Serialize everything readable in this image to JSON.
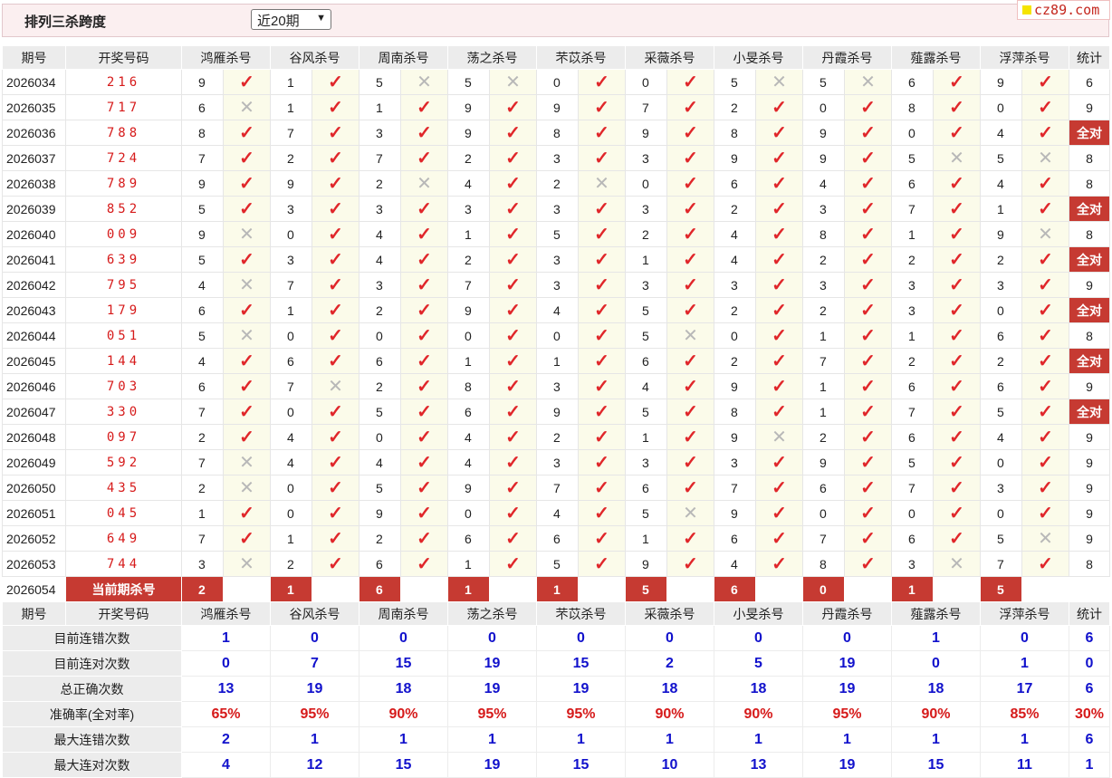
{
  "header": {
    "title": "排列三杀跨度",
    "period_select": "近20期",
    "site_logo": "cz89.com"
  },
  "columns": {
    "period": "期号",
    "number": "开奖号码",
    "experts": [
      "鸿雁杀号",
      "谷风杀号",
      "周南杀号",
      "荡之杀号",
      "芣苡杀号",
      "采薇杀号",
      "小旻杀号",
      "丹霞杀号",
      "薤露杀号",
      "浮萍杀号"
    ],
    "stat": "统计"
  },
  "rows": [
    {
      "period": "2026034",
      "number": "216",
      "kills": [
        9,
        1,
        5,
        5,
        0,
        0,
        5,
        5,
        6,
        9
      ],
      "ok": [
        1,
        1,
        0,
        0,
        1,
        1,
        0,
        0,
        1,
        1
      ],
      "stat": "6"
    },
    {
      "period": "2026035",
      "number": "717",
      "kills": [
        6,
        1,
        1,
        9,
        9,
        7,
        2,
        0,
        8,
        0
      ],
      "ok": [
        0,
        1,
        1,
        1,
        1,
        1,
        1,
        1,
        1,
        1
      ],
      "stat": "9"
    },
    {
      "period": "2026036",
      "number": "788",
      "kills": [
        8,
        7,
        3,
        9,
        8,
        9,
        8,
        9,
        0,
        4
      ],
      "ok": [
        1,
        1,
        1,
        1,
        1,
        1,
        1,
        1,
        1,
        1
      ],
      "stat": "全对"
    },
    {
      "period": "2026037",
      "number": "724",
      "kills": [
        7,
        2,
        7,
        2,
        3,
        3,
        9,
        9,
        5,
        5
      ],
      "ok": [
        1,
        1,
        1,
        1,
        1,
        1,
        1,
        1,
        0,
        0
      ],
      "stat": "8"
    },
    {
      "period": "2026038",
      "number": "789",
      "kills": [
        9,
        9,
        2,
        4,
        2,
        0,
        6,
        4,
        6,
        4
      ],
      "ok": [
        1,
        1,
        0,
        1,
        0,
        1,
        1,
        1,
        1,
        1
      ],
      "stat": "8"
    },
    {
      "period": "2026039",
      "number": "852",
      "kills": [
        5,
        3,
        3,
        3,
        3,
        3,
        2,
        3,
        7,
        1
      ],
      "ok": [
        1,
        1,
        1,
        1,
        1,
        1,
        1,
        1,
        1,
        1
      ],
      "stat": "全对"
    },
    {
      "period": "2026040",
      "number": "009",
      "kills": [
        9,
        0,
        4,
        1,
        5,
        2,
        4,
        8,
        1,
        9
      ],
      "ok": [
        0,
        1,
        1,
        1,
        1,
        1,
        1,
        1,
        1,
        0
      ],
      "stat": "8"
    },
    {
      "period": "2026041",
      "number": "639",
      "kills": [
        5,
        3,
        4,
        2,
        3,
        1,
        4,
        2,
        2,
        2
      ],
      "ok": [
        1,
        1,
        1,
        1,
        1,
        1,
        1,
        1,
        1,
        1
      ],
      "stat": "全对"
    },
    {
      "period": "2026042",
      "number": "795",
      "kills": [
        4,
        7,
        3,
        7,
        3,
        3,
        3,
        3,
        3,
        3
      ],
      "ok": [
        0,
        1,
        1,
        1,
        1,
        1,
        1,
        1,
        1,
        1
      ],
      "stat": "9"
    },
    {
      "period": "2026043",
      "number": "179",
      "kills": [
        6,
        1,
        2,
        9,
        4,
        5,
        2,
        2,
        3,
        0
      ],
      "ok": [
        1,
        1,
        1,
        1,
        1,
        1,
        1,
        1,
        1,
        1
      ],
      "stat": "全对"
    },
    {
      "period": "2026044",
      "number": "051",
      "kills": [
        5,
        0,
        0,
        0,
        0,
        5,
        0,
        1,
        1,
        6
      ],
      "ok": [
        0,
        1,
        1,
        1,
        1,
        0,
        1,
        1,
        1,
        1
      ],
      "stat": "8"
    },
    {
      "period": "2026045",
      "number": "144",
      "kills": [
        4,
        6,
        6,
        1,
        1,
        6,
        2,
        7,
        2,
        2
      ],
      "ok": [
        1,
        1,
        1,
        1,
        1,
        1,
        1,
        1,
        1,
        1
      ],
      "stat": "全对"
    },
    {
      "period": "2026046",
      "number": "703",
      "kills": [
        6,
        7,
        2,
        8,
        3,
        4,
        9,
        1,
        6,
        6
      ],
      "ok": [
        1,
        0,
        1,
        1,
        1,
        1,
        1,
        1,
        1,
        1
      ],
      "stat": "9"
    },
    {
      "period": "2026047",
      "number": "330",
      "kills": [
        7,
        0,
        5,
        6,
        9,
        5,
        8,
        1,
        7,
        5
      ],
      "ok": [
        1,
        1,
        1,
        1,
        1,
        1,
        1,
        1,
        1,
        1
      ],
      "stat": "全对"
    },
    {
      "period": "2026048",
      "number": "097",
      "kills": [
        2,
        4,
        0,
        4,
        2,
        1,
        9,
        2,
        6,
        4
      ],
      "ok": [
        1,
        1,
        1,
        1,
        1,
        1,
        0,
        1,
        1,
        1
      ],
      "stat": "9"
    },
    {
      "period": "2026049",
      "number": "592",
      "kills": [
        7,
        4,
        4,
        4,
        3,
        3,
        3,
        9,
        5,
        0
      ],
      "ok": [
        0,
        1,
        1,
        1,
        1,
        1,
        1,
        1,
        1,
        1
      ],
      "stat": "9"
    },
    {
      "period": "2026050",
      "number": "435",
      "kills": [
        2,
        0,
        5,
        9,
        7,
        6,
        7,
        6,
        7,
        3
      ],
      "ok": [
        0,
        1,
        1,
        1,
        1,
        1,
        1,
        1,
        1,
        1
      ],
      "stat": "9"
    },
    {
      "period": "2026051",
      "number": "045",
      "kills": [
        1,
        0,
        9,
        0,
        4,
        5,
        9,
        0,
        0,
        0
      ],
      "ok": [
        1,
        1,
        1,
        1,
        1,
        0,
        1,
        1,
        1,
        1
      ],
      "stat": "9"
    },
    {
      "period": "2026052",
      "number": "649",
      "kills": [
        7,
        1,
        2,
        6,
        6,
        1,
        6,
        7,
        6,
        5
      ],
      "ok": [
        1,
        1,
        1,
        1,
        1,
        1,
        1,
        1,
        1,
        0
      ],
      "stat": "9"
    },
    {
      "period": "2026053",
      "number": "744",
      "kills": [
        3,
        2,
        6,
        1,
        5,
        9,
        4,
        8,
        3,
        7
      ],
      "ok": [
        0,
        1,
        1,
        1,
        1,
        1,
        1,
        1,
        0,
        1
      ],
      "stat": "8"
    }
  ],
  "current": {
    "period": "2026054",
    "label": "当前期杀号",
    "kills": [
      2,
      1,
      6,
      1,
      1,
      5,
      6,
      0,
      1,
      5
    ]
  },
  "summary": [
    {
      "label": "目前连错次数",
      "values": [
        "1",
        "0",
        "0",
        "0",
        "0",
        "0",
        "0",
        "0",
        "1",
        "0"
      ],
      "stat": "6",
      "kind": "count"
    },
    {
      "label": "目前连对次数",
      "values": [
        "0",
        "7",
        "15",
        "19",
        "15",
        "2",
        "5",
        "19",
        "0",
        "1"
      ],
      "stat": "0",
      "kind": "count"
    },
    {
      "label": "总正确次数",
      "values": [
        "13",
        "19",
        "18",
        "19",
        "19",
        "18",
        "18",
        "19",
        "18",
        "17"
      ],
      "stat": "6",
      "kind": "count"
    },
    {
      "label": "准确率(全对率)",
      "values": [
        "65%",
        "95%",
        "90%",
        "95%",
        "95%",
        "90%",
        "90%",
        "95%",
        "90%",
        "85%"
      ],
      "stat": "30%",
      "kind": "pct"
    },
    {
      "label": "最大连错次数",
      "values": [
        "2",
        "1",
        "1",
        "1",
        "1",
        "1",
        "1",
        "1",
        "1",
        "1"
      ],
      "stat": "6",
      "kind": "count"
    },
    {
      "label": "最大连对次数",
      "values": [
        "4",
        "12",
        "15",
        "19",
        "15",
        "10",
        "13",
        "19",
        "15",
        "11"
      ],
      "stat": "1",
      "kind": "count"
    }
  ],
  "icons": {
    "correct": "check-icon",
    "wrong": "cross-icon"
  },
  "colors": {
    "accent": "#c63a32",
    "number_red": "#d61a1a",
    "stat_blue": "#1111cc",
    "check_red": "#e0262a"
  }
}
